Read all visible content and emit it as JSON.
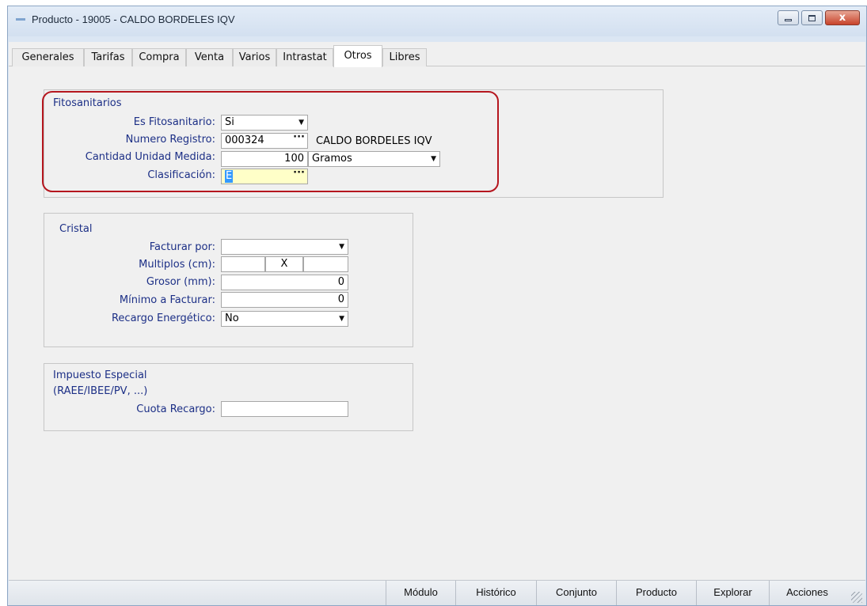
{
  "window": {
    "title": "Producto - 19005 - CALDO BORDELES IQV",
    "close_symbol": "x"
  },
  "tabs": [
    {
      "label": "Generales",
      "active": false
    },
    {
      "label": "Tarifas",
      "active": false
    },
    {
      "label": "Compra",
      "active": false
    },
    {
      "label": "Venta",
      "active": false
    },
    {
      "label": "Varios",
      "active": false
    },
    {
      "label": "Intrastat",
      "active": false
    },
    {
      "label": "Otros",
      "active": true
    },
    {
      "label": "Libres",
      "active": false
    }
  ],
  "fitosanitarios": {
    "title": "Fitosanitarios",
    "es_fito_label": "Es Fitosanitario:",
    "es_fito_value": "Si",
    "registro_label": "Numero Registro:",
    "registro_value": "000324",
    "registro_desc": "CALDO BORDELES IQV",
    "cantidad_label": "Cantidad Unidad Medida:",
    "cantidad_value": "100",
    "unidad_value": "Gramos",
    "clasificacion_label": "Clasificación:",
    "clasificacion_value": "E"
  },
  "cristal": {
    "title": "Cristal",
    "facturar_label": "Facturar por:",
    "facturar_value": "",
    "multiplos_label": "Multiplos (cm):",
    "multiplos_sep": "X",
    "grosor_label": "Grosor (mm):",
    "grosor_value": "0",
    "minimo_label": "Mínimo a Facturar:",
    "minimo_value": "0",
    "recargo_label": "Recargo Energético:",
    "recargo_value": "No"
  },
  "impuesto": {
    "title_line1": "Impuesto Especial",
    "title_line2": "(RAEE/IBEE/PV, ...)",
    "cuota_label": "Cuota Recargo:",
    "cuota_value": ""
  },
  "statusbar": {
    "buttons": [
      "Módulo",
      "Histórico",
      "Conjunto",
      "Producto",
      "Explorar",
      "Acciones"
    ]
  },
  "symbols": {
    "dropdown": "▼",
    "ellipsis": "···"
  }
}
